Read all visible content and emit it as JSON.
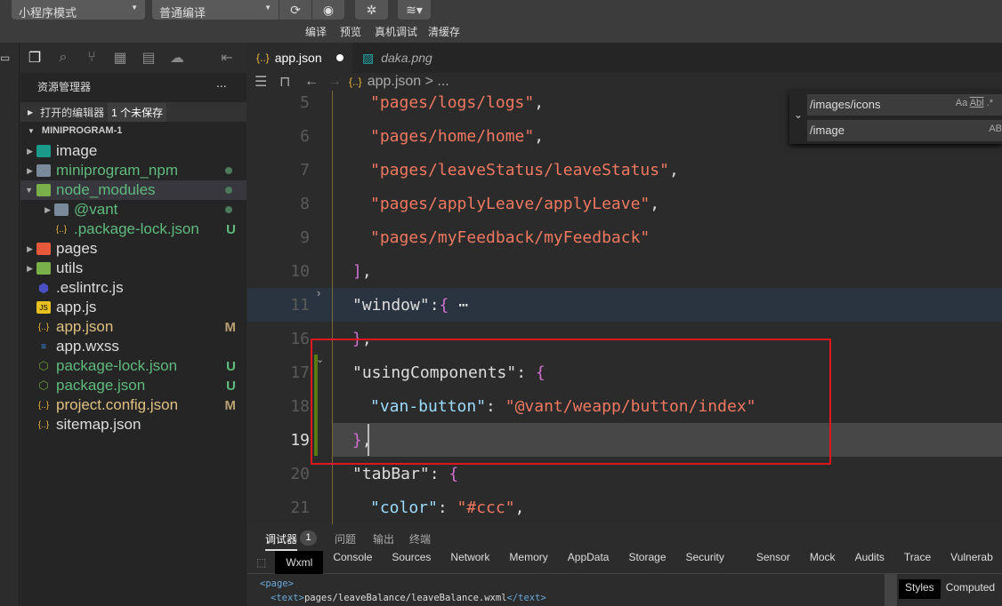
{
  "toolbar": {
    "mode": "小程序模式",
    "compile_mode": "普通编译",
    "compile": "编译",
    "preview": "预览",
    "remote_debug": "真机调试",
    "clear_cache": "清缓存"
  },
  "sidebar": {
    "title": "资源管理器",
    "more": "...",
    "open_editors": "打开的编辑器",
    "unsaved": "1 个未保存",
    "project": "MINIPROGRAM-1",
    "items": [
      {
        "name": "image",
        "badge": ""
      },
      {
        "name": "miniprogram_npm",
        "badge": ""
      },
      {
        "name": "node_modules",
        "badge": ""
      },
      {
        "name": "@vant",
        "badge": ""
      },
      {
        "name": ".package-lock.json",
        "badge": "U"
      },
      {
        "name": "pages",
        "badge": ""
      },
      {
        "name": "utils",
        "badge": ""
      },
      {
        "name": ".eslintrc.js",
        "badge": ""
      },
      {
        "name": "app.js",
        "badge": ""
      },
      {
        "name": "app.json",
        "badge": "M"
      },
      {
        "name": "app.wxss",
        "badge": ""
      },
      {
        "name": "package-lock.json",
        "badge": "U"
      },
      {
        "name": "package.json",
        "badge": "U"
      },
      {
        "name": "project.config.json",
        "badge": "M"
      },
      {
        "name": "sitemap.json",
        "badge": ""
      }
    ]
  },
  "editor": {
    "tabs": [
      {
        "label": "app.json",
        "dirty": true
      },
      {
        "label": "daka.png"
      }
    ],
    "breadcrumb": "app.json > ...",
    "find": {
      "search": "/images/icons",
      "replace": "/image",
      "case": "Aa",
      "word": "Abl",
      "regex": ".*",
      "preserve": "AB"
    },
    "lines": [
      {
        "n": "5",
        "indent": 1,
        "parts": [
          [
            "s",
            "\"pages/logs/logs\""
          ],
          [
            "p",
            ","
          ]
        ]
      },
      {
        "n": "6",
        "indent": 1,
        "parts": [
          [
            "s",
            "\"pages/home/home\""
          ],
          [
            "p",
            ","
          ]
        ]
      },
      {
        "n": "7",
        "indent": 1,
        "parts": [
          [
            "s",
            "\"pages/leaveStatus/leaveStatus\""
          ],
          [
            "p",
            ","
          ]
        ]
      },
      {
        "n": "8",
        "indent": 1,
        "parts": [
          [
            "s",
            "\"pages/applyLeave/applyLeave\""
          ],
          [
            "p",
            ","
          ]
        ]
      },
      {
        "n": "9",
        "indent": 1,
        "parts": [
          [
            "s",
            "\"pages/myFeedback/myFeedback\""
          ]
        ]
      },
      {
        "n": "10",
        "indent": 0,
        "parts": [
          [
            "b",
            "]"
          ],
          [
            "p",
            ","
          ]
        ]
      },
      {
        "n": "11",
        "indent": 0,
        "parts": [
          [
            "kw",
            "\"window\""
          ],
          [
            "p",
            ":"
          ],
          [
            "b",
            "{"
          ],
          [
            "p",
            " ⋯"
          ]
        ]
      },
      {
        "n": "16",
        "indent": 0,
        "parts": [
          [
            "b",
            "}"
          ],
          [
            "p",
            ","
          ]
        ]
      },
      {
        "n": "17",
        "indent": 0,
        "parts": [
          [
            "kw",
            "\"usingComponents\""
          ],
          [
            "p",
            ": "
          ],
          [
            "b",
            "{"
          ]
        ]
      },
      {
        "n": "18",
        "indent": 1,
        "parts": [
          [
            "k",
            "\"van-button\""
          ],
          [
            "p",
            ": "
          ],
          [
            "s",
            "\"@vant/weapp/button/index\""
          ]
        ]
      },
      {
        "n": "19",
        "indent": 0,
        "parts": [
          [
            "b",
            "}"
          ],
          [
            "p",
            ","
          ]
        ]
      },
      {
        "n": "20",
        "indent": 0,
        "parts": [
          [
            "kw",
            "\"tabBar\""
          ],
          [
            "p",
            ": "
          ],
          [
            "b",
            "{"
          ]
        ]
      },
      {
        "n": "21",
        "indent": 1,
        "parts": [
          [
            "k",
            "\"color\""
          ],
          [
            "p",
            ": "
          ],
          [
            "s",
            "\"#ccc\""
          ],
          [
            "p",
            ","
          ]
        ]
      }
    ]
  },
  "panel": {
    "tabs": [
      "调试器",
      "问题",
      "输出",
      "终端"
    ],
    "debugger_count": "1",
    "devtools_tabs": [
      "Wxml",
      "Console",
      "Sources",
      "Network",
      "Memory",
      "AppData",
      "Storage",
      "Security",
      "Sensor",
      "Mock",
      "Audits",
      "Trace",
      "Vulnerab"
    ],
    "wxml": [
      "<page>",
      "<text>",
      "pages/leaveBalance/leaveBalance.wxml",
      "</text>"
    ],
    "styles_tabs": [
      "Styles",
      "Computed"
    ]
  },
  "colors": {
    "highlight_box": "#e0161e",
    "string": "#f07860",
    "bracket": "#d070d0"
  }
}
